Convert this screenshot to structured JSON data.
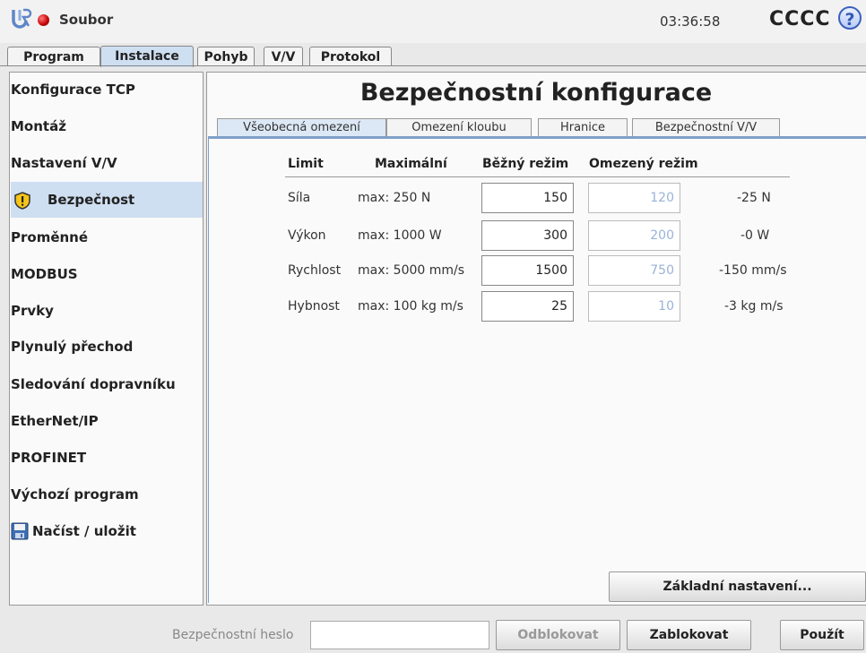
{
  "topbar": {
    "file_label": "Soubor",
    "clock": "03:36:58",
    "robot_name": "CCCC",
    "help_glyph": "?"
  },
  "main_tabs": [
    "Program",
    "Instalace",
    "Pohyb",
    "V/V",
    "Protokol"
  ],
  "sidebar": {
    "items": [
      {
        "label": "Konfigurace TCP"
      },
      {
        "label": "Montáž"
      },
      {
        "label": "Nastavení V/V"
      },
      {
        "label": "Bezpečnost",
        "icon": "warning-icon",
        "active": true
      },
      {
        "label": "Proměnné"
      },
      {
        "label": "MODBUS"
      },
      {
        "label": "Prvky"
      },
      {
        "label": "Plynulý přechod"
      },
      {
        "label": "Sledování dopravníku"
      },
      {
        "label": "EtherNet/IP"
      },
      {
        "label": "PROFINET"
      },
      {
        "label": "Výchozí program"
      },
      {
        "label": "Načíst / uložit",
        "icon": "save-icon"
      }
    ]
  },
  "page_title": "Bezpečnostní konfigurace",
  "sub_tabs": [
    "Všeobecná omezení",
    "Omezení kloubu",
    "Hranice",
    "Bezpečnostní V/V"
  ],
  "limits_table": {
    "headers": {
      "limit": "Limit",
      "max": "Maximální",
      "normal": "Běžný režim",
      "reduced": "Omezený režim"
    },
    "rows": [
      {
        "name": "Síla",
        "max": "max: 250 N",
        "normal": "150",
        "reduced": "120",
        "diff": "-25 N"
      },
      {
        "name": "Výkon",
        "max": "max: 1000 W",
        "normal": "300",
        "reduced": "200",
        "diff": "-0 W"
      },
      {
        "name": "Rychlost",
        "max": "max: 5000 mm/s",
        "normal": "1500",
        "reduced": "750",
        "diff": "-150 mm/s"
      },
      {
        "name": "Hybnost",
        "max": "max: 100 kg m/s",
        "normal": "25",
        "reduced": "10",
        "diff": "-3 kg m/s"
      }
    ]
  },
  "defaults_button": "Základní nastavení...",
  "footer": {
    "password_label": "Bezpečnostní heslo",
    "password_value": "",
    "unlock": "Odblokovat",
    "lock": "Zablokovat",
    "apply": "Použít"
  },
  "colors": {
    "accent": "#cfdff2",
    "tab_border": "#7fa0c8",
    "record": "#c40000"
  }
}
